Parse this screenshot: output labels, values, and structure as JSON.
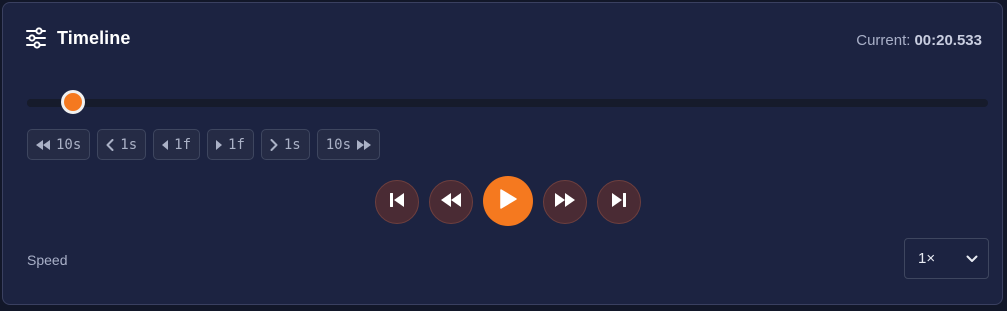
{
  "header": {
    "title": "Timeline",
    "current_label": "Current:",
    "current_value": "00:20.533"
  },
  "timeline": {
    "position_fraction": 0.045
  },
  "step_buttons": [
    {
      "label": "10s",
      "icon": "double-triangle-left-icon",
      "icon_side": "left"
    },
    {
      "label": "1s",
      "icon": "chevron-left-icon",
      "icon_side": "left"
    },
    {
      "label": "1f",
      "icon": "triangle-left-icon",
      "icon_side": "left"
    },
    {
      "label": "1f",
      "icon": "triangle-right-icon",
      "icon_side": "left"
    },
    {
      "label": "1s",
      "icon": "chevron-right-icon",
      "icon_side": "left"
    },
    {
      "label": "10s",
      "icon": "double-triangle-right-icon",
      "icon_side": "right"
    }
  ],
  "transport": {
    "buttons": [
      "skip-to-start-icon",
      "rewind-icon",
      "play-icon",
      "fast-forward-icon",
      "skip-to-end-icon"
    ]
  },
  "speed": {
    "label": "Speed",
    "selected": "1×"
  },
  "colors": {
    "accent": "#f5791f",
    "panel": "#1c2341",
    "background": "#121729",
    "transport_button": "#4a2b34"
  }
}
